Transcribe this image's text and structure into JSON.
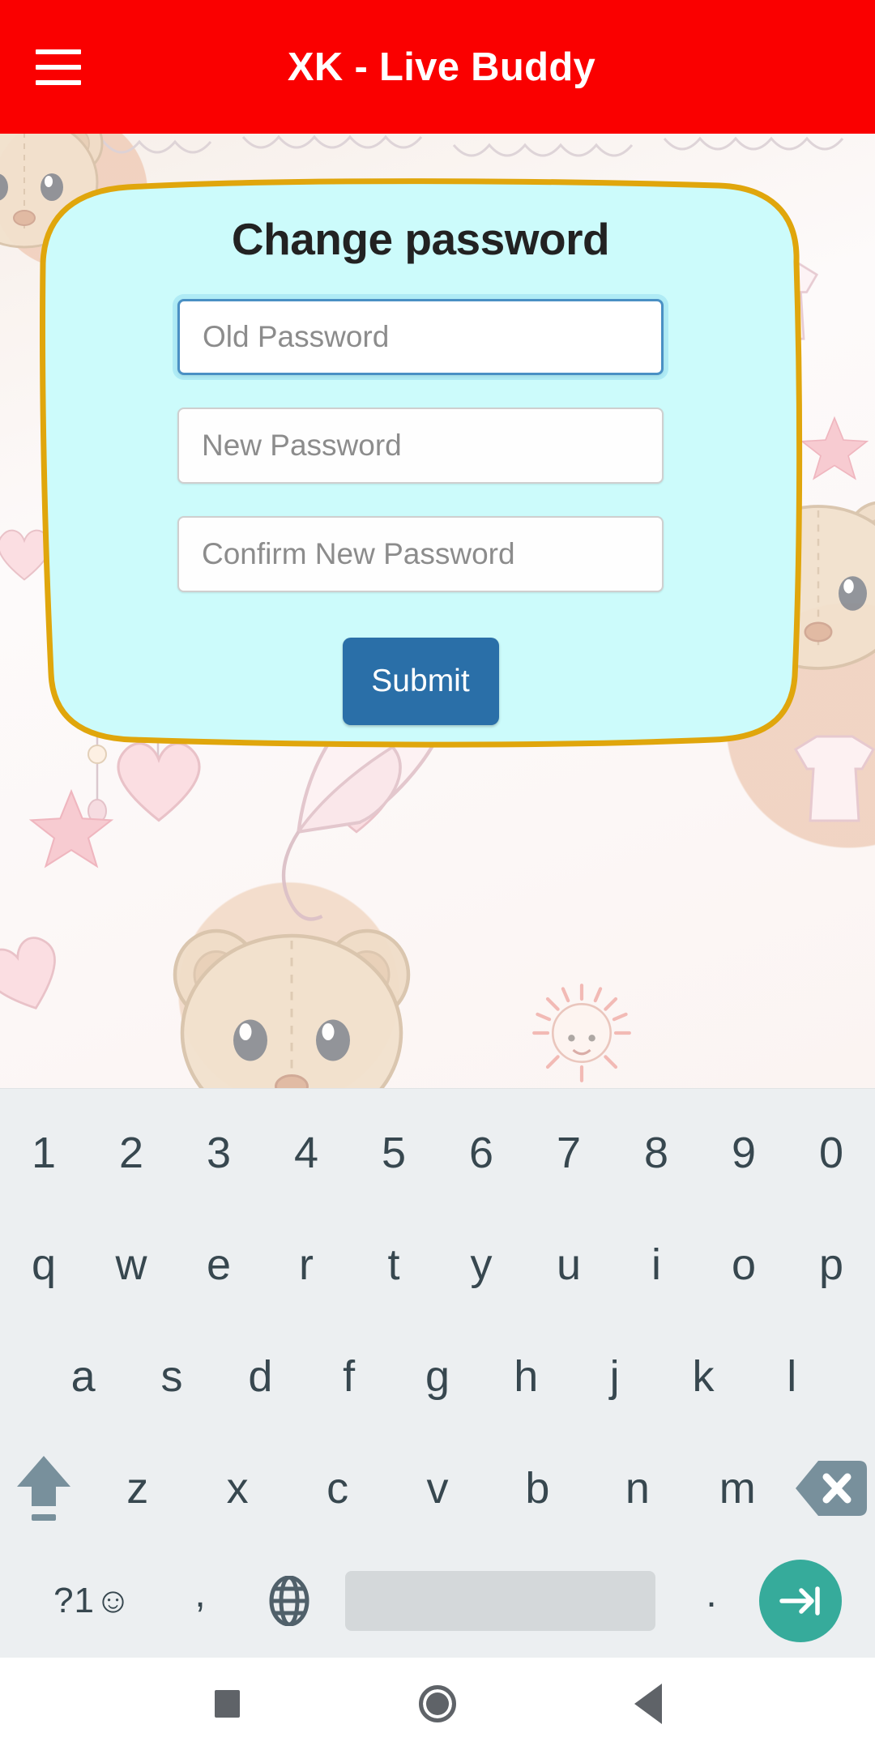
{
  "appbar": {
    "menu_icon": "hamburger-menu-icon",
    "title": "XK - Live Buddy",
    "bg_color": "#fa0000",
    "text_color": "#ffffff"
  },
  "card": {
    "title": "Change password",
    "bg_color": "#ccfbfb",
    "border_color": "#e0a60c",
    "fields": [
      {
        "placeholder": "Old Password",
        "value": "",
        "focused": true
      },
      {
        "placeholder": "New Password",
        "value": "",
        "focused": false
      },
      {
        "placeholder": "Confirm New Password",
        "value": "",
        "focused": false
      }
    ],
    "submit_label": "Submit",
    "submit_color": "#2a6fa8"
  },
  "keyboard": {
    "bg_color": "#eceff1",
    "key_text_color": "#37474f",
    "rows": {
      "digits": [
        "1",
        "2",
        "3",
        "4",
        "5",
        "6",
        "7",
        "8",
        "9",
        "0"
      ],
      "letters1": [
        "q",
        "w",
        "e",
        "r",
        "t",
        "y",
        "u",
        "i",
        "o",
        "p"
      ],
      "letters2": [
        "a",
        "s",
        "d",
        "f",
        "g",
        "h",
        "j",
        "k",
        "l"
      ],
      "letters3": [
        "z",
        "x",
        "c",
        "v",
        "b",
        "n",
        "m"
      ]
    },
    "shift_icon": "shift-arrow-icon",
    "backspace_icon": "backspace-icon",
    "symbols_label": "?1☺",
    "comma_label": ",",
    "globe_icon": "globe-language-icon",
    "space_label": "",
    "period_label": ".",
    "enter_icon": "next-field-arrow-icon",
    "enter_color": "#36ab9b"
  },
  "navbar": {
    "recents_icon": "square-recents-icon",
    "home_icon": "circle-home-icon",
    "back_icon": "triangle-back-icon",
    "icon_color": "#5f6368"
  }
}
